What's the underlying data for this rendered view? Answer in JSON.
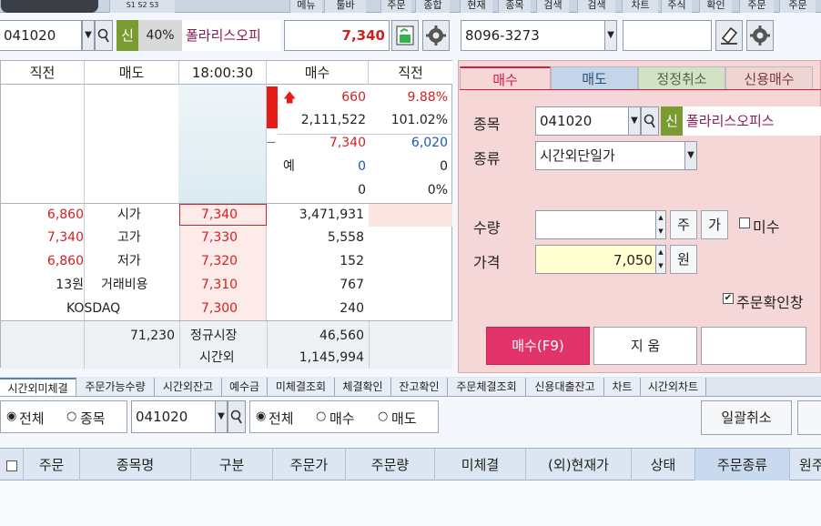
{
  "topmenu": [
    "메뉴",
    "툴바",
    "주문",
    "종합",
    "현재",
    "종목",
    "검색",
    "검색",
    "차트",
    "주식",
    "확인",
    "주문",
    "주문"
  ],
  "small_tags": [
    "S1",
    "S2",
    "S3"
  ],
  "toolbar": {
    "stock_code": "041020",
    "badge": "신",
    "margin_rate": "40%",
    "stock_name": "폴라리스오피",
    "price": "7,340",
    "account": "8096-3273",
    "password": ""
  },
  "quote": {
    "headers": [
      "직전",
      "매도",
      "18:00:30",
      "매수",
      "직전"
    ],
    "rows_upper": [
      {
        "c3": "660",
        "c4": "9.88%"
      },
      {
        "c3": "2,111,522",
        "c4": "101.02%"
      },
      {
        "c3": "7,340",
        "c4": "6,020"
      },
      {
        "lbl": "예",
        "c3": "0",
        "c4": "0"
      },
      {
        "c3": "0",
        "c4": "0%"
      }
    ],
    "rows_lower": [
      {
        "left": "6,860",
        "name": "시가",
        "price": "7,340",
        "vol": "3,471,931"
      },
      {
        "left": "7,340",
        "name": "고가",
        "price": "7,330",
        "vol": "5,558"
      },
      {
        "left": "6,860",
        "name": "저가",
        "price": "7,320",
        "vol": "152"
      },
      {
        "left": "13원",
        "name": "거래비용",
        "price": "7,310",
        "vol": "767"
      },
      {
        "left": "KOSDAQ",
        "name": "",
        "price": "7,300",
        "vol": "240"
      }
    ],
    "bottom": {
      "total": "71,230",
      "reg_label": "정규시장",
      "reg_val": "46,560",
      "after_label": "시간외",
      "after_val": "1,145,994"
    }
  },
  "ticket": {
    "tabs": [
      "매수",
      "매도",
      "정정취소",
      "신용매수"
    ],
    "stock_label": "종목",
    "stock_code": "041020",
    "badge": "신",
    "stock_name": "폴라리스오피스",
    "type_label": "종류",
    "type_value": "시간외단일가",
    "qty_label": "수량",
    "qty_value": "",
    "unit_shares": "주",
    "avail_btn": "가",
    "undec_label": "미수",
    "price_label": "가격",
    "price_value": "7,050",
    "unit_won": "원",
    "confirm_label": "주문확인창",
    "buy_btn": "매수(F9)",
    "clear_btn": "지  움"
  },
  "tabs2": [
    "시간외미체결",
    "주문가능수량",
    "시간외잔고",
    "예수금",
    "미체결조회",
    "체결확인",
    "잔고확인",
    "주문체결조회",
    "신용대출잔고",
    "차트",
    "시간외차트"
  ],
  "filters": {
    "all1": "전체",
    "stock1": "종목",
    "code": "041020",
    "all2": "전체",
    "buy": "매수",
    "sell": "매도",
    "cancel_all": "일괄취소"
  },
  "grid_headers": [
    "주문",
    "종목명",
    "구분",
    "주문가",
    "주문량",
    "미체결",
    "(외)현재가",
    "상태",
    "주문종류",
    "원주"
  ],
  "colors": {
    "red": "#d41f1f",
    "blue": "#1b55c4",
    "buy_btn": "#e2346b",
    "ticket_bg": "#f6d7d8"
  }
}
